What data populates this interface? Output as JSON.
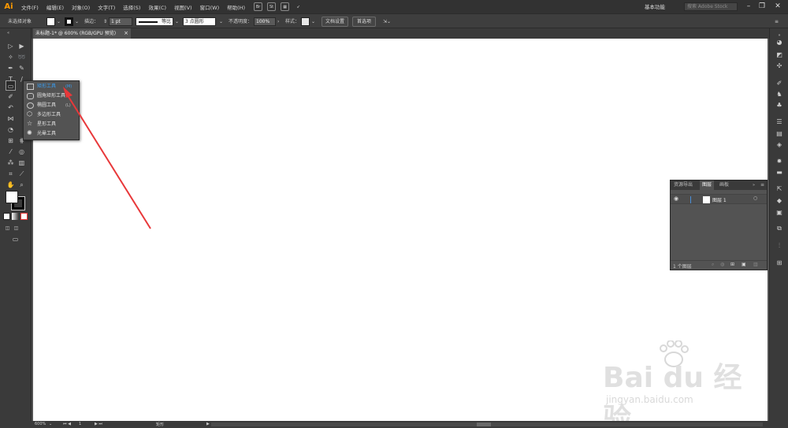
{
  "menubar": {
    "logo": "Ai",
    "items": [
      "文件(F)",
      "编辑(E)",
      "对象(O)",
      "文字(T)",
      "选择(S)",
      "效果(C)",
      "视图(V)",
      "窗口(W)",
      "帮助(H)"
    ],
    "bridge_label": "Br",
    "stock_label": "St",
    "workspace": "基本功能",
    "search_placeholder": "搜索 Adobe Stock"
  },
  "control_bar": {
    "selection_status": "未选择对象",
    "stroke_label": "描边：",
    "stroke_weight": "1 pt",
    "stroke_profile": "等比",
    "brush": "3 点圆形",
    "opacity_label": "不透明度：",
    "opacity_value": "100%",
    "style_label": "样式：",
    "document_setup_button": "文档设置",
    "preferences_button": "首选项"
  },
  "document_tab": {
    "title": "未标题-1* @ 600% (RGB/GPU 预览)",
    "close": "×"
  },
  "tool_flyout": {
    "items": [
      {
        "label": "矩形工具",
        "shortcut": "(M)",
        "icon": "rectangle-icon",
        "selected": true
      },
      {
        "label": "圆角矩形工具",
        "shortcut": "",
        "icon": "rounded-rectangle-icon",
        "selected": false
      },
      {
        "label": "椭圆工具",
        "shortcut": "(L)",
        "icon": "ellipse-icon",
        "selected": false
      },
      {
        "label": "多边形工具",
        "shortcut": "",
        "icon": "polygon-icon",
        "selected": false
      },
      {
        "label": "星形工具",
        "shortcut": "",
        "icon": "star-icon",
        "selected": false
      },
      {
        "label": "光晕工具",
        "shortcut": "",
        "icon": "flare-icon",
        "selected": false
      }
    ]
  },
  "layers_panel": {
    "tabs": [
      "资源导出",
      "图层",
      "画板"
    ],
    "active_tab": "图层",
    "layers": [
      {
        "name": "图层 1",
        "visible": true
      }
    ],
    "footer_count": "1 个图层"
  },
  "status_bar": {
    "zoom": "600%",
    "page": "1",
    "tool_name": "矩形"
  },
  "watermark": {
    "main": "Bai du 经验",
    "sub": "jingyan.baidu.com"
  },
  "colors": {
    "accent": "#3a9df0",
    "annotation_arrow": "#e8383a",
    "app_logo": "#ff9a00"
  }
}
